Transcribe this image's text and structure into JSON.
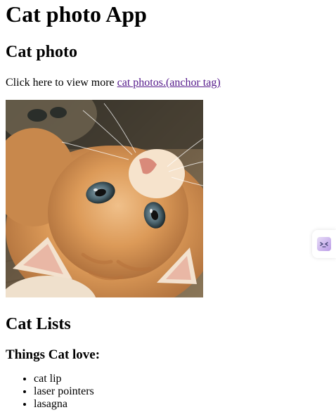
{
  "page": {
    "title": "Cat photo App",
    "photo_section_heading": "Cat photo",
    "intro_text": "Click here to view more ",
    "intro_link": "cat photos.(anchor tag)"
  },
  "photo": {
    "alt": "cat photo",
    "fur_color": "#e0a062",
    "floor_color": "#6b5a44"
  },
  "lists": {
    "heading": "Cat Lists",
    "subheading": "Things Cat love:",
    "items": [
      "cat lip",
      "laser pointers",
      "lasagna"
    ]
  },
  "side_widget": {
    "icon": "face-icon",
    "accent_color": "#b99ae6"
  }
}
